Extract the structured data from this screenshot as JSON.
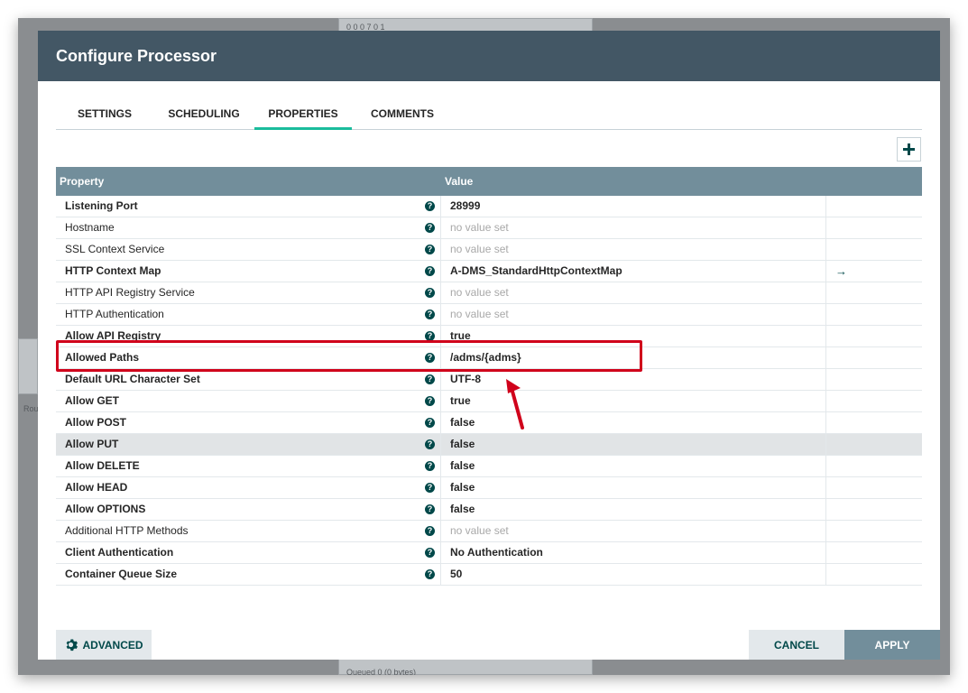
{
  "dialog": {
    "title": "Configure Processor"
  },
  "tabs": [
    {
      "label": "SETTINGS"
    },
    {
      "label": "SCHEDULING"
    },
    {
      "label": "PROPERTIES"
    },
    {
      "label": "COMMENTS"
    }
  ],
  "active_tab": "PROPERTIES",
  "table": {
    "headers": {
      "property": "Property",
      "value": "Value"
    },
    "rows": [
      {
        "name": "Listening Port",
        "value": "28999",
        "required": true,
        "empty": false
      },
      {
        "name": "Hostname",
        "value": "no value set",
        "required": false,
        "empty": true
      },
      {
        "name": "SSL Context Service",
        "value": "no value set",
        "required": false,
        "empty": true
      },
      {
        "name": "HTTP Context Map",
        "value": "A-DMS_StandardHttpContextMap",
        "required": true,
        "empty": false
      },
      {
        "name": "HTTP API Registry Service",
        "value": "no value set",
        "required": false,
        "empty": true
      },
      {
        "name": "HTTP Authentication",
        "value": "no value set",
        "required": false,
        "empty": true
      },
      {
        "name": "Allow API Registry",
        "value": "true",
        "required": true,
        "empty": false
      },
      {
        "name": "Allowed Paths",
        "value": "/adms/{adms}",
        "required": true,
        "empty": false
      },
      {
        "name": "Default URL Character Set",
        "value": "UTF-8",
        "required": true,
        "empty": false
      },
      {
        "name": "Allow GET",
        "value": "true",
        "required": true,
        "empty": false
      },
      {
        "name": "Allow POST",
        "value": "false",
        "required": true,
        "empty": false
      },
      {
        "name": "Allow PUT",
        "value": "false",
        "required": true,
        "empty": false
      },
      {
        "name": "Allow DELETE",
        "value": "false",
        "required": true,
        "empty": false
      },
      {
        "name": "Allow HEAD",
        "value": "false",
        "required": true,
        "empty": false
      },
      {
        "name": "Allow OPTIONS",
        "value": "false",
        "required": true,
        "empty": false
      },
      {
        "name": "Additional HTTP Methods",
        "value": "no value set",
        "required": false,
        "empty": true
      },
      {
        "name": "Client Authentication",
        "value": "No Authentication",
        "required": true,
        "empty": false
      },
      {
        "name": "Container Queue Size",
        "value": "50",
        "required": true,
        "empty": false
      }
    ]
  },
  "buttons": {
    "advanced": "ADVANCED",
    "cancel": "CANCEL",
    "apply": "APPLY"
  },
  "background": {
    "stats_text": "0  0  0  7  0  1",
    "queued_text": "Queued      0 (0 bytes)",
    "side_label": "Rou"
  },
  "colors": {
    "header": "#435765",
    "accent": "#1abc9c",
    "table_header": "#728e9b",
    "annotation": "#d0021b"
  },
  "icons": {
    "help": "question-circle-icon",
    "goto": "arrow-right-icon",
    "add": "plus-icon",
    "advanced": "gear-icon"
  }
}
